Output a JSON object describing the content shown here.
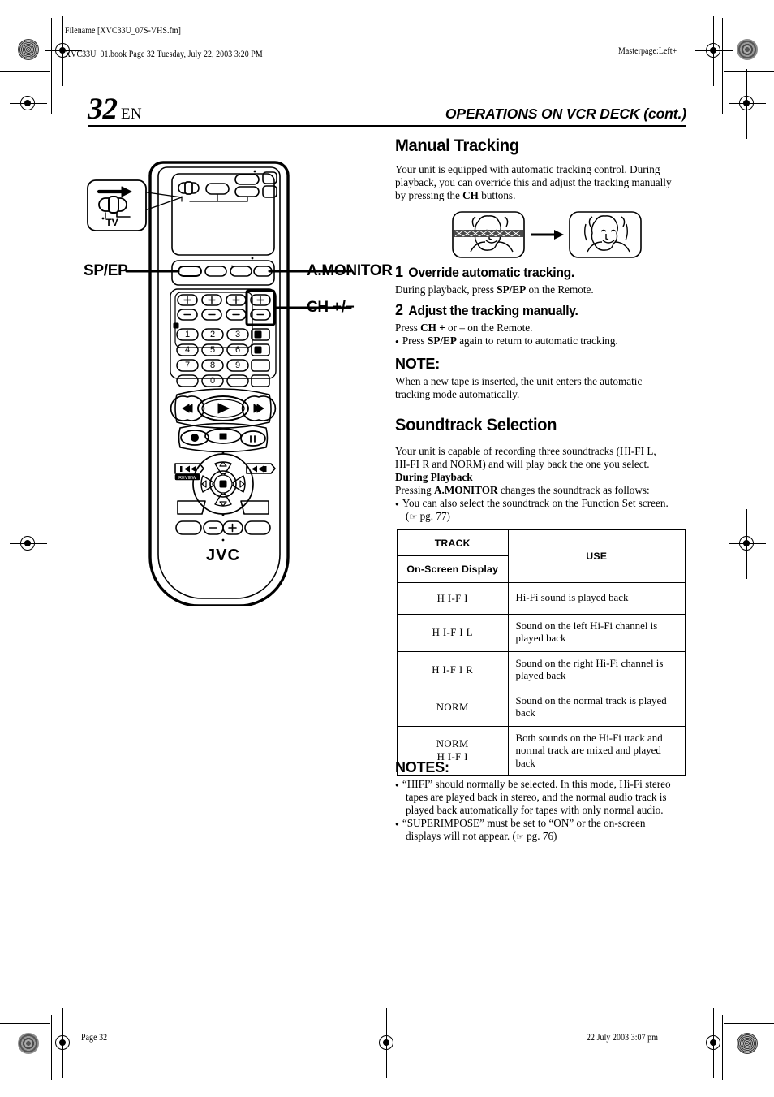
{
  "print_marks": {
    "filename_label": "Filename [XVC33U_07S-VHS.fm]",
    "book_line": "XVC33U_01.book  Page 32  Tuesday, July 22, 2003  3:20 PM",
    "masterpage": "Masterpage:Left+",
    "footer_left": "Page 32",
    "footer_right": "22 July 2003 3:07 pm"
  },
  "header": {
    "page_number": "32",
    "locale": "EN",
    "running_head": "OPERATIONS ON VCR DECK (cont.)"
  },
  "callouts": {
    "sp_ep": "SP/EP",
    "a_monitor": "A.MONITOR",
    "ch_plus_minus": "CH +/−",
    "tv_switch": "TV",
    "brand": "JVC",
    "keypad": [
      "1",
      "2",
      "3",
      "4",
      "5",
      "6",
      "7",
      "8",
      "9",
      "0"
    ],
    "review_label": "REVIEW"
  },
  "manual_tracking": {
    "heading": "Manual Tracking",
    "intro_1": "Your unit is equipped with automatic tracking control. During",
    "intro_2": "playback, you can override this and adjust the tracking manually",
    "intro_3_pre": "by pressing the ",
    "intro_3_bold": "CH",
    "intro_3_post": " buttons.",
    "steps": [
      {
        "number": "1",
        "title": "Override automatic tracking.",
        "text_pre": "During playback, press ",
        "text_bold": "SP/EP",
        "text_post": " on the Remote."
      },
      {
        "number": "2",
        "title": "Adjust the tracking manually.",
        "text_pre": "Press ",
        "text_bold": "CH +",
        "text_post": " or – on the Remote.",
        "bullet_pre": "Press ",
        "bullet_bold": "SP/EP",
        "bullet_post": " again to return to automatic tracking."
      }
    ],
    "note_heading": "NOTE:",
    "note_1": "When a new tape is inserted, the unit enters the automatic",
    "note_2": "tracking mode automatically."
  },
  "soundtrack": {
    "heading": "Soundtrack Selection",
    "intro_1": "Your unit is capable of recording three soundtracks (HI-FI L,",
    "intro_2": "HI-FI R and NORM) and will play back the one you select.",
    "during_playback": "During Playback",
    "pressing_pre": "Pressing ",
    "pressing_bold": "A.MONITOR",
    "pressing_post": " changes the soundtrack as follows:",
    "bullet_1": "You can also select the soundtrack on the Function Set screen.",
    "bullet_1_ref": "pg. 77)",
    "table": {
      "header_track": "TRACK",
      "header_osd": "On-Screen Display",
      "header_use": "USE",
      "rows": [
        {
          "track": "H I-F I",
          "use": "Hi-Fi sound is played back"
        },
        {
          "track": "H I-F I L",
          "use": "Sound on the left Hi-Fi channel is played back"
        },
        {
          "track": "H I-F I R",
          "use": "Sound on the right Hi-Fi channel is played back"
        },
        {
          "track": "NORM",
          "use": "Sound on the normal track is played back"
        },
        {
          "track": "NORM\nH I-F I",
          "use": "Both sounds on the Hi-Fi track and normal track are mixed and played back"
        }
      ]
    },
    "notes_heading": "NOTES:",
    "note_a_1": "“HIFI” should normally be selected. In this mode, Hi-Fi stereo",
    "note_a_2": "tapes are played back in stereo, and the normal audio track is",
    "note_a_3": "played back automatically for tapes with only normal audio.",
    "note_b_1": "“SUPERIMPOSE” must be set to “ON” or the on-screen",
    "note_b_2_pre": "displays will not appear. (",
    "note_b_2_ref": "pg. 76)"
  },
  "colors": {
    "ink": "#000000",
    "paper": "#ffffff",
    "noise_band": "#3a3a3a"
  }
}
